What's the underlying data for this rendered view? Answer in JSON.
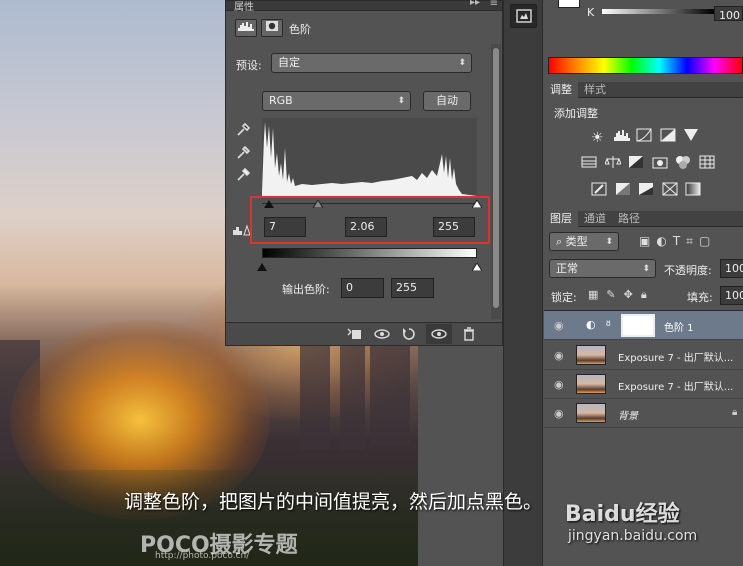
{
  "properties_panel": {
    "tab_label": "属性",
    "arrows": "▸▸",
    "menu": "≡",
    "adjustment_name": "色阶",
    "preset_label": "预设:",
    "preset_value": "自定",
    "channel_value": "RGB",
    "auto_button": "自动",
    "input_black": "7",
    "input_gamma": "2.06",
    "input_white": "255",
    "output_label": "输出色阶:",
    "output_black": "0",
    "output_white": "255"
  },
  "color_panel": {
    "k_label": "K",
    "k_value": "100"
  },
  "adjustments_panel": {
    "tab_adjust": "调整",
    "tab_style": "样式",
    "add_label": "添加调整"
  },
  "layers_panel": {
    "tab_layers": "图层",
    "tab_channels": "通道",
    "tab_paths": "路径",
    "filter_value": "类型",
    "blend_mode": "正常",
    "opacity_label": "不透明度:",
    "opacity_value": "100",
    "lock_label": "锁定:",
    "fill_label": "填充:",
    "fill_value": "100",
    "layers": [
      {
        "name": "色阶 1"
      },
      {
        "name": "Exposure 7 - 出厂默认..."
      },
      {
        "name": "Exposure 7 - 出厂默认..."
      },
      {
        "name": "背景"
      }
    ]
  },
  "caption": "调整色阶，把图片的中间值提亮，然后加点黑色。",
  "watermarks": {
    "poco": "POCO摄影专题",
    "poco_url": "http://photo.poco.cn/",
    "baidu": "Baidu经验",
    "baidu_url": "jingyan.baidu.com"
  },
  "colors": {
    "panel_bg": "#535353",
    "highlight_box": "#e03030",
    "selected_layer": "#6d7a8c"
  }
}
